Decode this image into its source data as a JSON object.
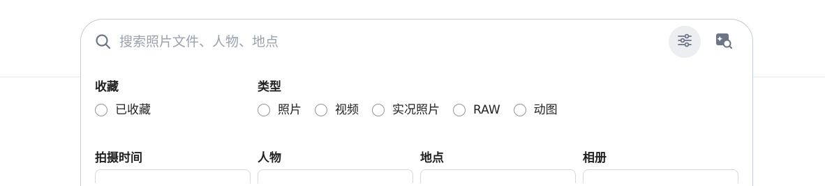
{
  "search": {
    "placeholder": "搜索照片文件、人物、地点",
    "value": ""
  },
  "icons": {
    "search": "search-icon",
    "filter": "sliders-icon",
    "image_search": "image-search-icon"
  },
  "filters": {
    "favorites": {
      "title": "收藏",
      "options": [
        "已收藏"
      ]
    },
    "type": {
      "title": "类型",
      "options": [
        "照片",
        "视频",
        "实况照片",
        "RAW",
        "动图"
      ]
    },
    "date": {
      "title": "拍摄时间"
    },
    "people": {
      "title": "人物"
    },
    "location": {
      "title": "地点"
    },
    "album": {
      "title": "相册"
    }
  },
  "colors": {
    "border": "#c2ccd8",
    "icon": "#6b7585",
    "placeholder": "#9aa2ad",
    "filter_button_bg": "#eceef1"
  }
}
